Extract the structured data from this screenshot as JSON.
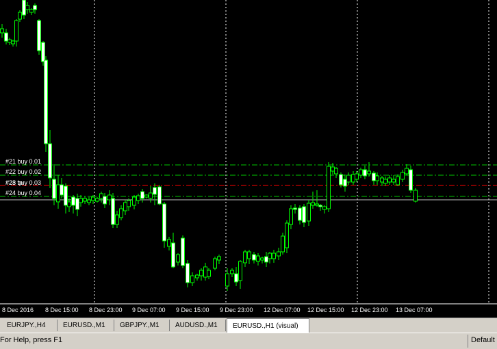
{
  "chart": {
    "symbol": "EURUSD.",
    "timeframe": "H1",
    "colors": {
      "background": "#000000",
      "bull_body": "#000000",
      "bear_body": "#ffffff",
      "candle_outline": "#00ff00",
      "order_line": "#00c800",
      "red_line": "#ff0000",
      "price_line": "#c0c0c0",
      "period_separator": "#ffffff"
    },
    "orders": [
      {
        "label": "#21 buy 0.01",
        "kind": "order-line"
      },
      {
        "label": "#22 buy 0.02",
        "kind": "order-line"
      },
      {
        "label": "#23 buy 0.03",
        "kind": "order-line"
      },
      {
        "label": "#24 buy 0.04",
        "kind": "order-line"
      }
    ],
    "overlap_label": "#28 tp",
    "time_labels": [
      "8 Dec 2016",
      "8 Dec 15:00",
      "8 Dec 23:00",
      "9 Dec 07:00",
      "9 Dec 15:00",
      "9 Dec 23:00",
      "12 Dec 07:00",
      "12 Dec 15:00",
      "12 Dec 23:00",
      "13 Dec 07:00"
    ]
  },
  "tabs": [
    {
      "label": "EURJPY.,H4",
      "active": false
    },
    {
      "label": "EURUSD.,M1",
      "active": false
    },
    {
      "label": "GBPJPY.,M1",
      "active": false
    },
    {
      "label": "AUDUSD.,M1",
      "active": false
    },
    {
      "label": "EURUSD.,H1 (visual)",
      "active": true
    }
  ],
  "status": {
    "help_text": "For Help, press F1",
    "profile": "Default"
  }
}
